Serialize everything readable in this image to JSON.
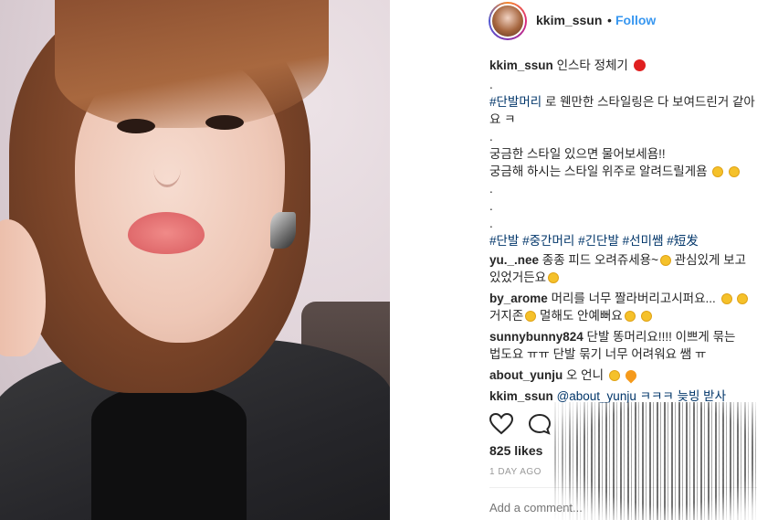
{
  "header": {
    "username": "kkim_ssun",
    "separator": "•",
    "follow_label": "Follow"
  },
  "caption": {
    "username": "kkim_ssun",
    "title": "인스타 정체기",
    "lines": [
      ".",
      "#단발머리 로 웬만한 스타일링은 다 보여드린거 같아",
      "요 ㅋ",
      ".",
      "궁금한 스타일 있으면 물어보세욤!!",
      "궁금해 하시는 스타일 위주로 알려드릴게욤",
      ".",
      ".",
      "."
    ],
    "hashtags": [
      "#단발",
      "#중간머리",
      "#긴단발",
      "#선미쌤",
      "#短发"
    ]
  },
  "comments": [
    {
      "username": "yu._.nee",
      "line1": "종종 피드 오려쥬세용~",
      "line1_tail": "관심있게 보고",
      "line2": "있었거든요"
    },
    {
      "username": "by_arome",
      "line1": "머리를 너무 짤라버리고시퍼요...",
      "line2": "거지존",
      "line2_tail": "멀해도 안예뻐요"
    },
    {
      "username": "sunnybunny824",
      "line1": "단발 똥머리요!!!! 이쁘게 묶는",
      "line2": "법도요 ㅠㅠ 단발 묶기 너무 어려워요 쌤 ㅠ"
    },
    {
      "username": "about_yunju",
      "line1": "오 언니"
    },
    {
      "username": "kkim_ssun",
      "line1": "@about_yunju ㅋㅋㅋ 늦빙 받사"
    }
  ],
  "actions": {
    "like_icon": "heart-icon",
    "comment_icon": "comment-icon"
  },
  "likes": "825 likes",
  "timestamp": "1 DAY AGO",
  "add_comment_placeholder": "Add a comment..."
}
